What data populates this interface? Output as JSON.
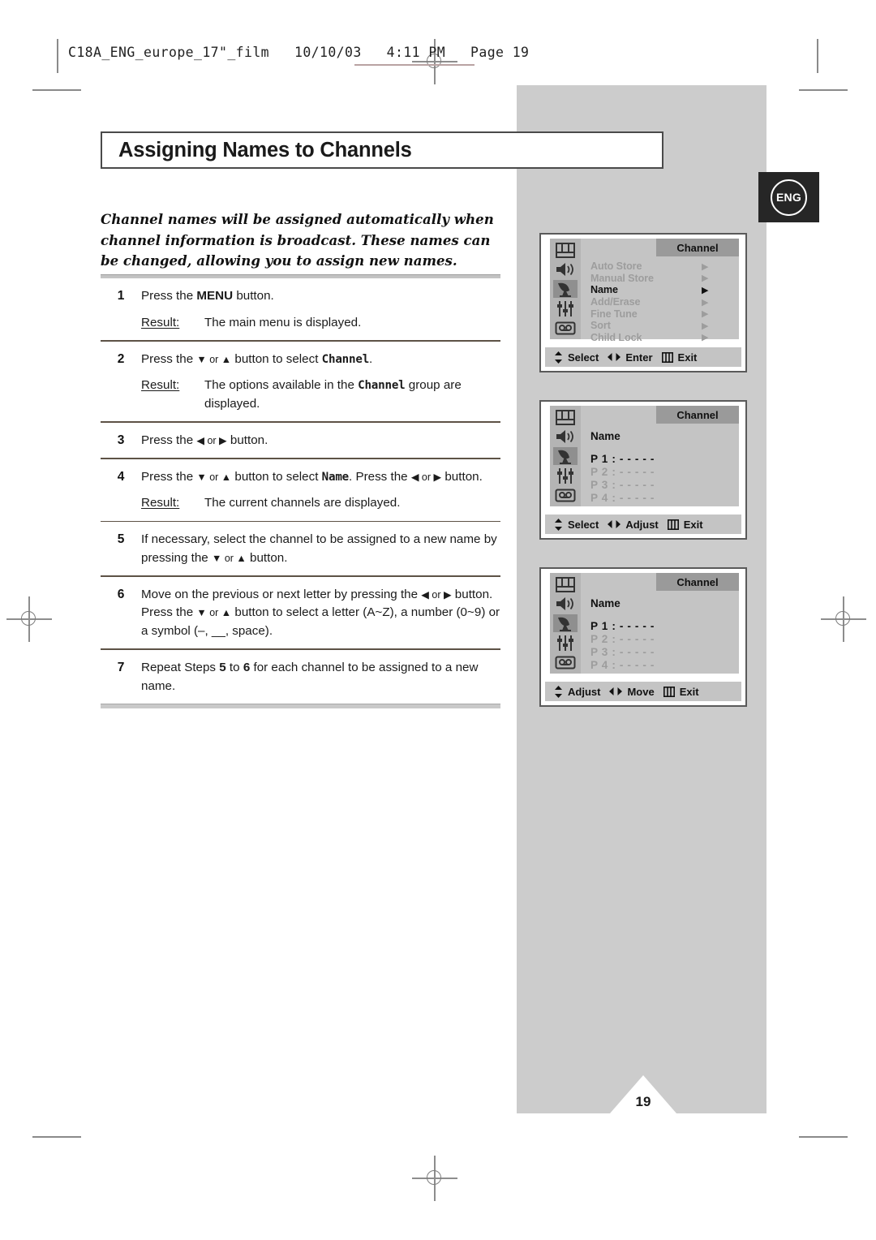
{
  "print_slug": {
    "text": "C18A_ENG_europe_17\"_film   10/10/03   4:11 PM   Page 19"
  },
  "badge": {
    "language": "ENG"
  },
  "page": {
    "title": "Assigning Names to Channels",
    "number": "19"
  },
  "intro": {
    "text": "Channel names will be assigned automatically when channel information is broadcast. These names can be changed, allowing you to assign new names."
  },
  "steps": [
    {
      "num": "1",
      "line1_pre": "Press the ",
      "line1_bold": "MENU",
      "line1_post": " button.",
      "result_label": "Result:",
      "result_text": "The main menu is displayed."
    },
    {
      "num": "2",
      "line1_pre": "Press the ",
      "line1_arrows": "▼ or ▲",
      "line1_mid": " button to select ",
      "line1_mono": "Channel",
      "line1_post": ".",
      "result_label": "Result:",
      "result_pre": "The options available in the ",
      "result_mono": "Channel",
      "result_post": " group are displayed."
    },
    {
      "num": "3",
      "line1_pre": "Press the ",
      "line1_arrows": "◀ or ▶",
      "line1_post": " button."
    },
    {
      "num": "4",
      "line1_pre": "Press the ",
      "line1_arrows": "▼ or ▲",
      "line1_mid": " button to select ",
      "line1_mono": "Name",
      "line1_mid2": ". Press the ",
      "line1_arrows2": "◀ or ▶",
      "line1_post": " button.",
      "result_label": "Result:",
      "result_text": "The current channels are displayed."
    },
    {
      "num": "5",
      "line1_pre": "If necessary, select the channel to be assigned to a new name by pressing the ",
      "line1_arrows": "▼ or ▲",
      "line1_post": " button."
    },
    {
      "num": "6",
      "line1_pre": "Move on the previous or next letter by pressing the ",
      "line1_arrows": "◀ or ▶",
      "line1_post": " button. Press the ",
      "line2_arrows": "▼ or ▲",
      "line2_post": " button to select a letter (A~Z), a number (0~9) or a symbol (–, __, space)."
    },
    {
      "num": "7",
      "line1_pre": "Repeat Steps ",
      "line1_b1": "5",
      "line1_mid": " to ",
      "line1_b2": "6",
      "line1_post": " for each channel to be assigned to a new name."
    }
  ],
  "osd_panels": [
    {
      "tab": "Channel",
      "icons": [
        "picture-icon",
        "sound-icon",
        "channel-icon",
        "feature-icon",
        "vcr-icon"
      ],
      "selected_icon_index": 2,
      "menu_items": [
        {
          "label": "Auto Store",
          "active": false
        },
        {
          "label": "Manual Store",
          "active": false
        },
        {
          "label": "Name",
          "active": true
        },
        {
          "label": "Add/Erase",
          "active": false
        },
        {
          "label": "Fine Tune",
          "active": false
        },
        {
          "label": "Sort",
          "active": false
        },
        {
          "label": "Child Lock",
          "active": false
        }
      ],
      "footer": [
        {
          "icon": "updown-arrow-icon",
          "label": "Select"
        },
        {
          "icon": "leftright-arrow-icon",
          "label": "Enter"
        },
        {
          "icon": "menu-bars-icon",
          "label": "Exit"
        }
      ]
    },
    {
      "tab": "Channel",
      "icons": [
        "picture-icon",
        "sound-icon",
        "channel-icon",
        "feature-icon",
        "vcr-icon"
      ],
      "selected_icon_index": 2,
      "heading": "Name",
      "channels": [
        {
          "label": "P 1 : - - - - -",
          "active": true
        },
        {
          "label": "P 2 : - - - - -",
          "active": false
        },
        {
          "label": "P 3 : - - - - -",
          "active": false
        },
        {
          "label": "P 4 : - - - - -",
          "active": false
        }
      ],
      "footer": [
        {
          "icon": "updown-arrow-icon",
          "label": "Select"
        },
        {
          "icon": "leftright-arrow-icon",
          "label": "Adjust"
        },
        {
          "icon": "menu-bars-icon",
          "label": "Exit"
        }
      ]
    },
    {
      "tab": "Channel",
      "icons": [
        "picture-icon",
        "sound-icon",
        "channel-icon",
        "feature-icon",
        "vcr-icon"
      ],
      "selected_icon_index": 2,
      "heading": "Name",
      "channels": [
        {
          "label": "P 1 : - - - - -",
          "active": true
        },
        {
          "label": "P 2 : - - - - -",
          "active": false
        },
        {
          "label": "P 3 : - - - - -",
          "active": false
        },
        {
          "label": "P 4 : - - - - -",
          "active": false
        }
      ],
      "footer": [
        {
          "icon": "updown-arrow-icon",
          "label": "Adjust"
        },
        {
          "icon": "leftright-arrow-icon",
          "label": "Move"
        },
        {
          "icon": "menu-bars-icon",
          "label": "Exit"
        }
      ]
    }
  ],
  "colors": {
    "panel_gray": "#cccccc",
    "osd_content": "#c4c4c4",
    "osd_tab": "#9a9a9a",
    "osd_iconbar": "#b4b4b4",
    "badge_dark": "#262626"
  }
}
